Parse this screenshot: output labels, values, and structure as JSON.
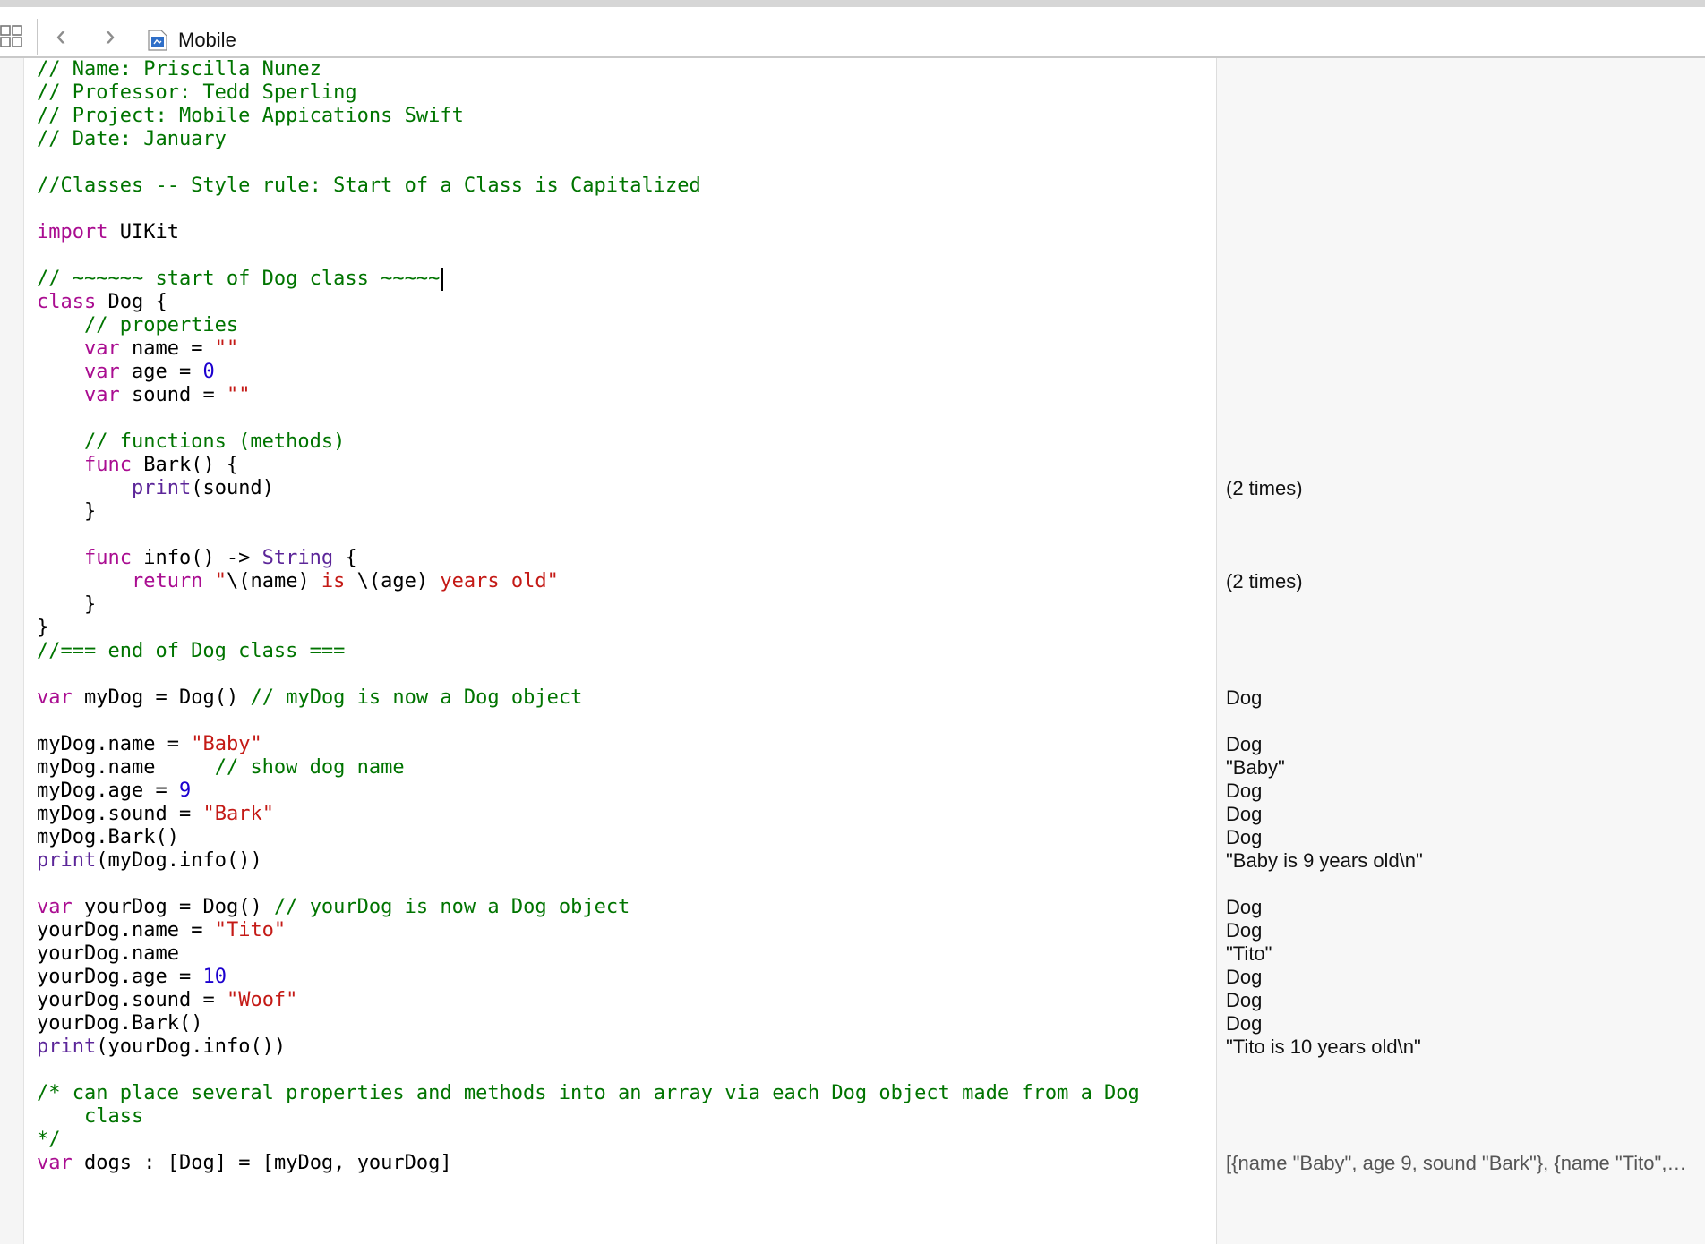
{
  "window": {
    "title": "Mobile"
  },
  "colors": {
    "comment": "#007400",
    "keyword": "#aa0d91",
    "string": "#c41a16",
    "number": "#1c00cf",
    "type": "#5c2699",
    "identifier": "#3f6e74",
    "plain": "#000000"
  },
  "icons": {
    "layout": "grid-layout-icon",
    "back": "chevron-left-icon",
    "forward": "chevron-right-icon",
    "file": "swift-playground-file-icon"
  },
  "code_lines": [
    [
      {
        "t": "// Name: Priscilla Nunez",
        "c": "comment"
      }
    ],
    [
      {
        "t": "// Professor: Tedd Sperling",
        "c": "comment"
      }
    ],
    [
      {
        "t": "// Project: Mobile Appications Swift",
        "c": "comment"
      }
    ],
    [
      {
        "t": "// Date: January",
        "c": "comment"
      }
    ],
    [],
    [
      {
        "t": "//Classes -- Style rule: Start of a Class is Capitalized",
        "c": "comment"
      }
    ],
    [],
    [
      {
        "t": "import",
        "c": "keyword"
      },
      {
        "t": " UIKit",
        "c": "plain"
      }
    ],
    [],
    [
      {
        "t": "// ~~~~~~ start of Dog class ~~~~~",
        "c": "comment"
      }
    ],
    [
      {
        "t": "class",
        "c": "keyword"
      },
      {
        "t": " Dog {",
        "c": "plain"
      }
    ],
    [
      {
        "t": "    // properties",
        "c": "comment"
      }
    ],
    [
      {
        "t": "    ",
        "c": "plain"
      },
      {
        "t": "var",
        "c": "keyword"
      },
      {
        "t": " name = ",
        "c": "plain"
      },
      {
        "t": "\"\"",
        "c": "string"
      }
    ],
    [
      {
        "t": "    ",
        "c": "plain"
      },
      {
        "t": "var",
        "c": "keyword"
      },
      {
        "t": " age = ",
        "c": "plain"
      },
      {
        "t": "0",
        "c": "number"
      }
    ],
    [
      {
        "t": "    ",
        "c": "plain"
      },
      {
        "t": "var",
        "c": "keyword"
      },
      {
        "t": " sound = ",
        "c": "plain"
      },
      {
        "t": "\"\"",
        "c": "string"
      }
    ],
    [],
    [
      {
        "t": "    // functions (methods)",
        "c": "comment"
      }
    ],
    [
      {
        "t": "    ",
        "c": "plain"
      },
      {
        "t": "func",
        "c": "keyword"
      },
      {
        "t": " Bark() {",
        "c": "plain"
      }
    ],
    [
      {
        "t": "        ",
        "c": "plain"
      },
      {
        "t": "print",
        "c": "type"
      },
      {
        "t": "(",
        "c": "plain"
      },
      {
        "t": "sound",
        "c": "identifier"
      },
      {
        "t": ")",
        "c": "plain"
      }
    ],
    [
      {
        "t": "    }",
        "c": "plain"
      }
    ],
    [],
    [
      {
        "t": "    ",
        "c": "plain"
      },
      {
        "t": "func",
        "c": "keyword"
      },
      {
        "t": " info() -> ",
        "c": "plain"
      },
      {
        "t": "String",
        "c": "type"
      },
      {
        "t": " {",
        "c": "plain"
      }
    ],
    [
      {
        "t": "        ",
        "c": "plain"
      },
      {
        "t": "return",
        "c": "keyword"
      },
      {
        "t": " ",
        "c": "plain"
      },
      {
        "t": "\"",
        "c": "string"
      },
      {
        "t": "\\(",
        "c": "plain"
      },
      {
        "t": "name",
        "c": "identifier"
      },
      {
        "t": ")",
        "c": "plain"
      },
      {
        "t": " is ",
        "c": "string"
      },
      {
        "t": "\\(",
        "c": "plain"
      },
      {
        "t": "age",
        "c": "identifier"
      },
      {
        "t": ")",
        "c": "plain"
      },
      {
        "t": " years old\"",
        "c": "string"
      }
    ],
    [
      {
        "t": "    }",
        "c": "plain"
      }
    ],
    [
      {
        "t": "}",
        "c": "plain"
      }
    ],
    [
      {
        "t": "//=== end of Dog class ===",
        "c": "comment"
      }
    ],
    [],
    [
      {
        "t": "var",
        "c": "keyword"
      },
      {
        "t": " myDog = ",
        "c": "plain"
      },
      {
        "t": "Dog",
        "c": "identifier"
      },
      {
        "t": "() ",
        "c": "plain"
      },
      {
        "t": "// myDog is now a Dog object",
        "c": "comment"
      }
    ],
    [],
    [
      {
        "t": "myDog",
        "c": "identifier"
      },
      {
        "t": ".",
        "c": "plain"
      },
      {
        "t": "name",
        "c": "identifier"
      },
      {
        "t": " = ",
        "c": "plain"
      },
      {
        "t": "\"Baby\"",
        "c": "string"
      }
    ],
    [
      {
        "t": "myDog",
        "c": "identifier"
      },
      {
        "t": ".",
        "c": "plain"
      },
      {
        "t": "name",
        "c": "identifier"
      },
      {
        "t": "     ",
        "c": "plain"
      },
      {
        "t": "// show dog name",
        "c": "comment"
      }
    ],
    [
      {
        "t": "myDog",
        "c": "identifier"
      },
      {
        "t": ".",
        "c": "plain"
      },
      {
        "t": "age",
        "c": "identifier"
      },
      {
        "t": " = ",
        "c": "plain"
      },
      {
        "t": "9",
        "c": "number"
      }
    ],
    [
      {
        "t": "myDog",
        "c": "identifier"
      },
      {
        "t": ".",
        "c": "plain"
      },
      {
        "t": "sound",
        "c": "identifier"
      },
      {
        "t": " = ",
        "c": "plain"
      },
      {
        "t": "\"Bark\"",
        "c": "string"
      }
    ],
    [
      {
        "t": "myDog",
        "c": "identifier"
      },
      {
        "t": ".",
        "c": "plain"
      },
      {
        "t": "Bark",
        "c": "identifier"
      },
      {
        "t": "()",
        "c": "plain"
      }
    ],
    [
      {
        "t": "print",
        "c": "type"
      },
      {
        "t": "(",
        "c": "plain"
      },
      {
        "t": "myDog",
        "c": "identifier"
      },
      {
        "t": ".",
        "c": "plain"
      },
      {
        "t": "info",
        "c": "identifier"
      },
      {
        "t": "())",
        "c": "plain"
      }
    ],
    [],
    [
      {
        "t": "var",
        "c": "keyword"
      },
      {
        "t": " yourDog = ",
        "c": "plain"
      },
      {
        "t": "Dog",
        "c": "identifier"
      },
      {
        "t": "() ",
        "c": "plain"
      },
      {
        "t": "// yourDog is now a Dog object",
        "c": "comment"
      }
    ],
    [
      {
        "t": "yourDog",
        "c": "identifier"
      },
      {
        "t": ".",
        "c": "plain"
      },
      {
        "t": "name",
        "c": "identifier"
      },
      {
        "t": " = ",
        "c": "plain"
      },
      {
        "t": "\"Tito\"",
        "c": "string"
      }
    ],
    [
      {
        "t": "yourDog",
        "c": "identifier"
      },
      {
        "t": ".",
        "c": "plain"
      },
      {
        "t": "name",
        "c": "identifier"
      }
    ],
    [
      {
        "t": "yourDog",
        "c": "identifier"
      },
      {
        "t": ".",
        "c": "plain"
      },
      {
        "t": "age",
        "c": "identifier"
      },
      {
        "t": " = ",
        "c": "plain"
      },
      {
        "t": "10",
        "c": "number"
      }
    ],
    [
      {
        "t": "yourDog",
        "c": "identifier"
      },
      {
        "t": ".",
        "c": "plain"
      },
      {
        "t": "sound",
        "c": "identifier"
      },
      {
        "t": " = ",
        "c": "plain"
      },
      {
        "t": "\"Woof\"",
        "c": "string"
      }
    ],
    [
      {
        "t": "yourDog",
        "c": "identifier"
      },
      {
        "t": ".",
        "c": "plain"
      },
      {
        "t": "Bark",
        "c": "identifier"
      },
      {
        "t": "()",
        "c": "plain"
      }
    ],
    [
      {
        "t": "print",
        "c": "type"
      },
      {
        "t": "(",
        "c": "plain"
      },
      {
        "t": "yourDog",
        "c": "identifier"
      },
      {
        "t": ".",
        "c": "plain"
      },
      {
        "t": "info",
        "c": "identifier"
      },
      {
        "t": "())",
        "c": "plain"
      }
    ],
    [],
    [
      {
        "t": "/* can place several properties and methods into an array via each Dog object made from a Dog",
        "c": "comment"
      }
    ],
    [
      {
        "t": "    class",
        "c": "comment"
      }
    ],
    [
      {
        "t": "*/",
        "c": "comment"
      }
    ],
    [
      {
        "t": "var",
        "c": "keyword"
      },
      {
        "t": " dogs : [",
        "c": "plain"
      },
      {
        "t": "Dog",
        "c": "identifier"
      },
      {
        "t": "] = [",
        "c": "plain"
      },
      {
        "t": "myDog",
        "c": "identifier"
      },
      {
        "t": ", ",
        "c": "plain"
      },
      {
        "t": "yourDog",
        "c": "identifier"
      },
      {
        "t": "]",
        "c": "plain"
      }
    ]
  ],
  "results": [
    {
      "line": 19,
      "text": "(2 times)"
    },
    {
      "line": 23,
      "text": "(2 times)"
    },
    {
      "line": 28,
      "text": "Dog"
    },
    {
      "line": 30,
      "text": "Dog"
    },
    {
      "line": 31,
      "text": "\"Baby\""
    },
    {
      "line": 32,
      "text": "Dog"
    },
    {
      "line": 33,
      "text": "Dog"
    },
    {
      "line": 34,
      "text": "Dog"
    },
    {
      "line": 35,
      "text": "\"Baby is 9 years old\\n\""
    },
    {
      "line": 37,
      "text": "Dog"
    },
    {
      "line": 38,
      "text": "Dog"
    },
    {
      "line": 39,
      "text": "\"Tito\""
    },
    {
      "line": 40,
      "text": "Dog"
    },
    {
      "line": 41,
      "text": "Dog"
    },
    {
      "line": 42,
      "text": "Dog"
    },
    {
      "line": 43,
      "text": "\"Tito is 10 years old\\n\""
    },
    {
      "line": 48,
      "text": "[{name \"Baby\", age 9, sound \"Bark\"}, {name \"Tito\",…",
      "dim": true
    }
  ],
  "cursor_line": 10
}
